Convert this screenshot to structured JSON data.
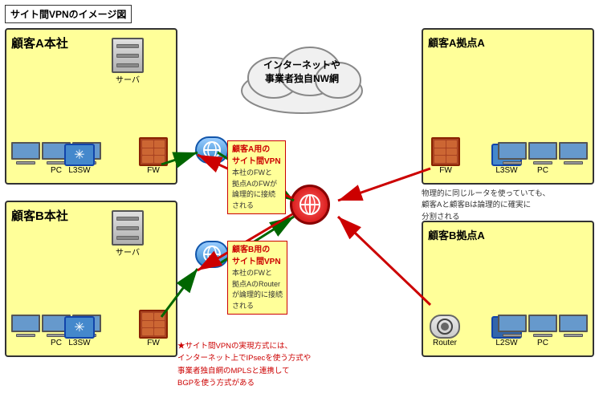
{
  "title": "サイト間VPNのイメージ図",
  "internet_label": "インターネットや\n事業者独自NW網",
  "left": {
    "top": {
      "title": "顧客A本社",
      "server_label": "サーバ",
      "l3sw_label": "L3SW",
      "fw_label": "FW",
      "pc_label": "PC"
    },
    "bottom": {
      "title": "顧客B本社",
      "server_label": "サーバ",
      "l3sw_label": "L3SW",
      "fw_label": "FW",
      "pc_label": "PC"
    }
  },
  "right": {
    "top": {
      "title": "顧客A拠点A",
      "fw_label": "FW",
      "l3sw_label": "L3SW",
      "pc_label": "PC"
    },
    "bottom": {
      "title": "顧客B拠点A",
      "router_label": "Router",
      "l2sw_label": "L2SW",
      "pc_label": "PC"
    }
  },
  "vpn_a": {
    "title": "顧客A用の\nサイト間VPN",
    "desc": "本社のFWと\n拠点AのFWが\n論理的に接続\nされる"
  },
  "vpn_b": {
    "title": "顧客B用の\nサイト間VPN",
    "desc": "本社のFWと\n拠点AのRouter\nが論理的に接続\nされる"
  },
  "note_top_right": "物理的に同じルータを使っていても、\n顧客Aと顧客Bは論理的に確実に\n分割される",
  "note_bottom": "★サイト間VPNの実現方式には、\nインターネット上でIPsecを使う方式や\n事業者独自網のMPLSと連携して\nBGPを使う方式がある"
}
